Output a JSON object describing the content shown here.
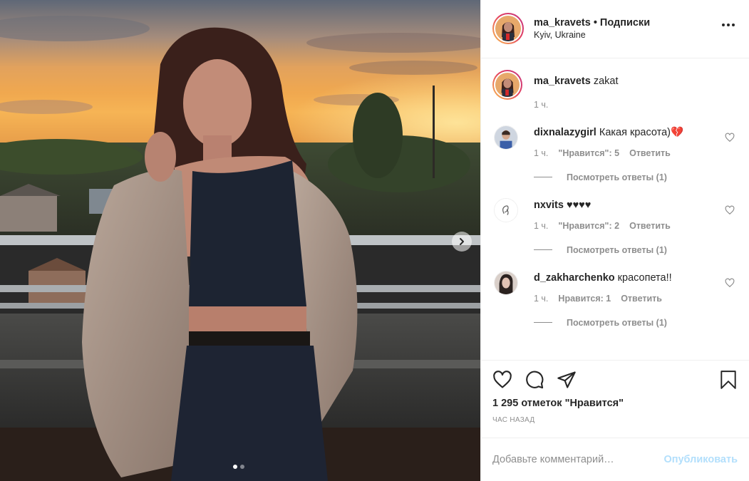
{
  "header": {
    "username": "ma_kravets",
    "separator": "•",
    "follow_status": "Подписки",
    "location": "Kyiv, Ukraine",
    "more_icon": "more-horizontal-icon"
  },
  "caption": {
    "username": "ma_kravets",
    "text": "zakat",
    "time": "1 ч."
  },
  "comments": [
    {
      "username": "dixnalazygirl",
      "text": "Какая красота)💔",
      "time": "1 ч.",
      "likes": "\"Нравится\": 5",
      "reply": "Ответить",
      "view_replies": "Посмотреть ответы (1)"
    },
    {
      "username": "nxvits",
      "text": "♥♥♥♥",
      "time": "1 ч.",
      "likes": "\"Нравится\": 2",
      "reply": "Ответить",
      "view_replies": "Посмотреть ответы (1)"
    },
    {
      "username": "d_zakharchenko",
      "text": "красопета!!",
      "time": "1 ч.",
      "likes": "Нравится: 1",
      "reply": "Ответить",
      "view_replies": "Посмотреть ответы (1)"
    }
  ],
  "actions": {
    "like_icon": "heart-icon",
    "comment_icon": "comment-icon",
    "share_icon": "share-icon",
    "save_icon": "bookmark-icon"
  },
  "likes_count": "1 295 отметок \"Нравится\"",
  "posted_time": "ЧАС НАЗАД",
  "add_comment": {
    "placeholder": "Добавьте комментарий…",
    "publish_label": "Опубликовать"
  },
  "carousel": {
    "slide_count": 2,
    "active_index": 0
  },
  "colors": {
    "text": "#262626",
    "muted": "#8e8e8e",
    "publish_disabled": "#b2dffc",
    "border": "#efefef"
  }
}
